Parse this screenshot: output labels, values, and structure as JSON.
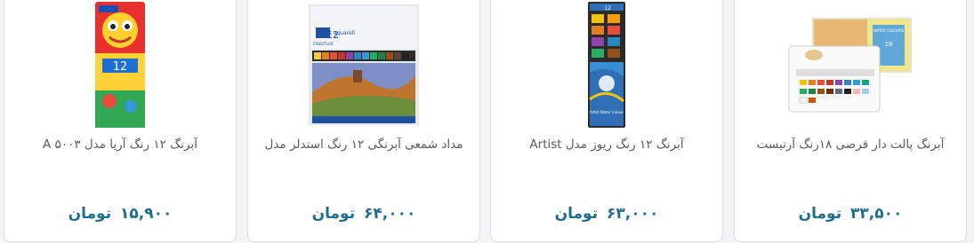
{
  "products": [
    {
      "title": "آبرنگ ۱۲ رنگ آریا مدل ۵۰۰۳ A",
      "price": "۱۵,۹۰۰",
      "currency": "تومان",
      "image_icon": "aria-watercolor-box-icon"
    },
    {
      "title": "مداد شمعی آبرنگی ۱۲ رنگ استدلر مدل",
      "price": "۶۴,۰۰۰",
      "currency": "تومان",
      "image_icon": "staedtler-karat-aquarell-box-icon",
      "image_text": [
        "STAEDTLER",
        "12",
        "karat aquarell"
      ]
    },
    {
      "title": "آبرنگ ۱۲ رنگ ریوز مدل Artist",
      "price": "۶۳,۰۰۰",
      "currency": "تومان",
      "image_icon": "reeves-watercolor-tin-icon",
      "image_text": [
        "12",
        "Artist Water Colour"
      ]
    },
    {
      "title": "آبرنگ پالت دار قرصی ۱۸رنگ آرتیست",
      "price": "۳۳,۵۰۰",
      "currency": "تومان",
      "image_icon": "watercolor-palette-18-icon",
      "image_text": [
        "WATER COLOURS",
        "18"
      ]
    }
  ]
}
